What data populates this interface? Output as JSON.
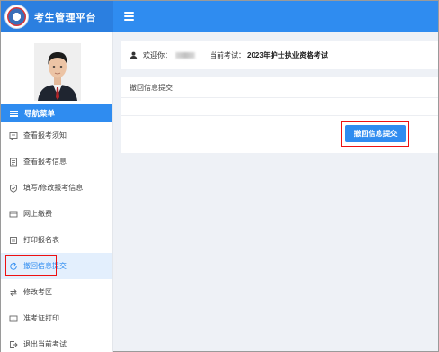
{
  "header": {
    "title": "考生管理平台",
    "logo_icon": "school-emblem-icon",
    "menu_toggle_icon": "hamburger-icon"
  },
  "sidebar": {
    "nav_title": "导航菜单",
    "items": [
      {
        "label": "查看报考须知",
        "icon": "notice-icon"
      },
      {
        "label": "查看报考信息",
        "icon": "document-icon"
      },
      {
        "label": "填写/修改报考信息",
        "icon": "shield-check-icon"
      },
      {
        "label": "网上缴费",
        "icon": "card-icon"
      },
      {
        "label": "打印报名表",
        "icon": "printer-icon"
      },
      {
        "label": "撤回信息提交",
        "icon": "undo-icon",
        "active": true
      },
      {
        "label": "修改考区",
        "icon": "swap-icon"
      },
      {
        "label": "准考证打印",
        "icon": "ticket-icon"
      },
      {
        "label": "退出当前考试",
        "icon": "exit-icon"
      }
    ]
  },
  "welcome": {
    "greeting": "欢迎你：",
    "current_exam_label": "当前考试：",
    "current_exam": "2023年护士执业资格考试"
  },
  "panel": {
    "title": "撤回信息提交",
    "submit_label": "撤回信息提交"
  },
  "colors": {
    "primary": "#2f8cf0",
    "highlight_outline": "#ee1111"
  }
}
